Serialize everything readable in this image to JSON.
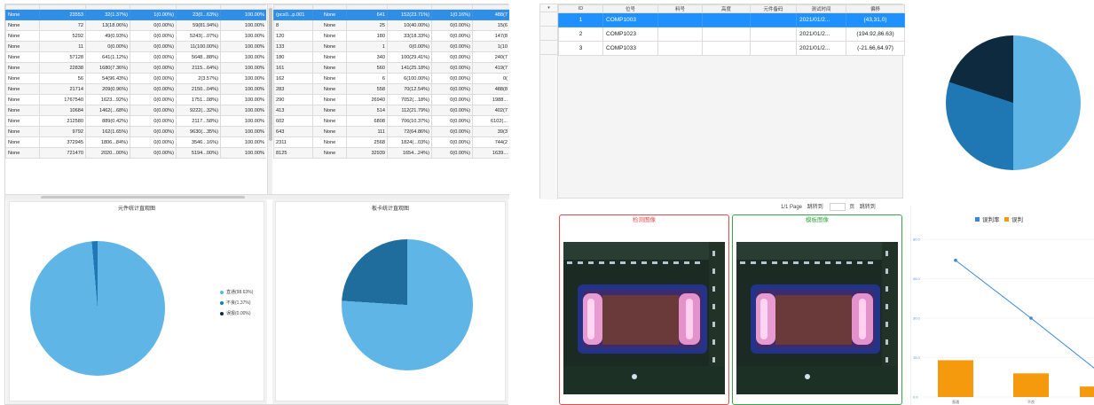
{
  "left_app": {
    "table_a": {
      "rows": [
        {
          "c0": "None",
          "c1": "23553",
          "c2": "32(1.37%)",
          "c3": "1(0.00%)",
          "c4": "23(0...63%)",
          "c5": "100.00%",
          "selected": true
        },
        {
          "c0": "None",
          "c1": "72",
          "c2": "13(18.06%)",
          "c3": "0(0.00%)",
          "c4": "59(81.94%)",
          "c5": "100.00%"
        },
        {
          "c0": "None",
          "c1": "5292",
          "c2": "49(0.93%)",
          "c3": "0(0.00%)",
          "c4": "5243(...07%)",
          "c5": "100.00%"
        },
        {
          "c0": "None",
          "c1": "11",
          "c2": "0(0.00%)",
          "c3": "0(0.00%)",
          "c4": "11(100.00%)",
          "c5": "100.00%"
        },
        {
          "c0": "None",
          "c1": "57128",
          "c2": "641(1.12%)",
          "c3": "0(0.00%)",
          "c4": "5648...88%)",
          "c5": "100.00%"
        },
        {
          "c0": "None",
          "c1": "22838",
          "c2": "1680(7.36%)",
          "c3": "0(0.00%)",
          "c4": "2115...64%)",
          "c5": "100.00%"
        },
        {
          "c0": "None",
          "c1": "56",
          "c2": "54(96.43%)",
          "c3": "0(0.00%)",
          "c4": "2(3.57%)",
          "c5": "100.00%"
        },
        {
          "c0": "None",
          "c1": "21714",
          "c2": "209(0.96%)",
          "c3": "0(0.00%)",
          "c4": "2150...04%)",
          "c5": "100.00%"
        },
        {
          "c0": "None",
          "c1": "1767540",
          "c2": "1623...92%)",
          "c3": "0(0.00%)",
          "c4": "1751...08%)",
          "c5": "100.00%"
        },
        {
          "c0": "None",
          "c1": "10684",
          "c2": "1462(...68%)",
          "c3": "0(0.00%)",
          "c4": "9222(...32%)",
          "c5": "100.00%"
        },
        {
          "c0": "None",
          "c1": "212580",
          "c2": "889(0.42%)",
          "c3": "0(0.00%)",
          "c4": "2117...58%)",
          "c5": "100.00%"
        },
        {
          "c0": "None",
          "c1": "9792",
          "c2": "162(1.65%)",
          "c3": "0(0.00%)",
          "c4": "9630(...35%)",
          "c5": "100.00%"
        },
        {
          "c0": "None",
          "c1": "372945",
          "c2": "1806...84%)",
          "c3": "0(0.00%)",
          "c4": "3546...16%)",
          "c5": "100.00%"
        },
        {
          "c0": "None",
          "c1": "721470",
          "c2": "2020...00%)",
          "c3": "0(0.00%)",
          "c4": "5194...00%)",
          "c5": "100.00%"
        }
      ]
    },
    "table_b": {
      "rows": [
        {
          "c0": "(pcs0...p.001",
          "c1": "None",
          "c2": "641",
          "c3": "152(23.71%)",
          "c4": "1(0.16%)",
          "c5": "488(7",
          "selected": true
        },
        {
          "c0": "8",
          "c1": "None",
          "c2": "25",
          "c3": "10(40.00%)",
          "c4": "0(0.00%)",
          "c5": "15(6"
        },
        {
          "c0": "120",
          "c1": "None",
          "c2": "180",
          "c3": "33(18.33%)",
          "c4": "0(0.00%)",
          "c5": "147(8"
        },
        {
          "c0": "133",
          "c1": "None",
          "c2": "1",
          "c3": "0(0.00%)",
          "c4": "0(0.00%)",
          "c5": "1(10"
        },
        {
          "c0": "180",
          "c1": "None",
          "c2": "340",
          "c3": "100(29.41%)",
          "c4": "0(0.00%)",
          "c5": "240(7"
        },
        {
          "c0": "161",
          "c1": "None",
          "c2": "560",
          "c3": "141(25.18%)",
          "c4": "0(0.00%)",
          "c5": "419(7"
        },
        {
          "c0": "162",
          "c1": "None",
          "c2": "6",
          "c3": "6(100.00%)",
          "c4": "0(0.00%)",
          "c5": "0("
        },
        {
          "c0": "283",
          "c1": "None",
          "c2": "558",
          "c3": "70(12.54%)",
          "c4": "0(0.00%)",
          "c5": "488(8"
        },
        {
          "c0": "290",
          "c1": "None",
          "c2": "26940",
          "c3": "7052(...18%)",
          "c4": "0(0.00%)",
          "c5": "1988..."
        },
        {
          "c0": "413",
          "c1": "None",
          "c2": "514",
          "c3": "112(21.79%)",
          "c4": "0(0.00%)",
          "c5": "402(7"
        },
        {
          "c0": "602",
          "c1": "None",
          "c2": "6808",
          "c3": "706(10.37%)",
          "c4": "0(0.00%)",
          "c5": "6102(..."
        },
        {
          "c0": "643",
          "c1": "None",
          "c2": "111",
          "c3": "72(64.86%)",
          "c4": "0(0.00%)",
          "c5": "39(3"
        },
        {
          "c0": "2311",
          "c1": "None",
          "c2": "2568",
          "c3": "1824(...03%)",
          "c4": "0(0.00%)",
          "c5": "744(2"
        },
        {
          "c0": "8125",
          "c1": "None",
          "c2": "32939",
          "c3": "1654...24%)",
          "c4": "0(0.00%)",
          "c5": "1639..."
        }
      ]
    },
    "pie_left": {
      "title": "元件统计直观图",
      "legend": [
        {
          "label": "直通(98.63%)",
          "color": "#5eb5e6"
        },
        {
          "label": "不良(1.37%)",
          "color": "#1f78b4"
        },
        {
          "label": "误报(0.00%)",
          "color": "#102a3c"
        }
      ],
      "slices": [
        0.9863,
        0.0137,
        0.0
      ]
    },
    "pie_right": {
      "title": "板卡统计直观图",
      "slices": [
        0.76,
        0.24
      ],
      "colors": [
        "#5eb5e6",
        "#1f6d9c"
      ]
    }
  },
  "right_app": {
    "table": {
      "header": {
        "corner": "▾",
        "id": "ID",
        "pos": "位号",
        "part": "料号",
        "height": "高度",
        "remark": "元件备码",
        "test_time": "测试时间",
        "offset": "偏移"
      },
      "rows": [
        {
          "id": "1",
          "pos": "COMP1003",
          "test_time": "2021/01/2...",
          "offset": "(43,31,0)",
          "selected": true
        },
        {
          "id": "2",
          "pos": "COMP1023",
          "test_time": "2021/01/2...",
          "offset": "(194.92,86.63)"
        },
        {
          "id": "3",
          "pos": "COMP1033",
          "test_time": "2021/01/2...",
          "offset": "(-21.66,64.97)"
        }
      ]
    },
    "pager": {
      "page": "1/1 Page",
      "jump": "跳转到",
      "unit": "页",
      "go": "跳转到"
    },
    "pie": {
      "slices": [
        0.5,
        0.3,
        0.2
      ],
      "colors": [
        "#5eb5e6",
        "#1f78b4",
        "#0e2a3f"
      ]
    },
    "image_panels": {
      "detect": "检测图像",
      "template": "模板图像"
    },
    "combo_chart": {
      "legend_line": "误判率",
      "legend_bar": "误判",
      "line_color": "#3a86d8",
      "bar_color": "#f59a0c",
      "y_ticks": [
        "60.0",
        "45.0",
        "30.0",
        "15.0",
        "0.0"
      ],
      "categories": [
        "直通",
        "不良",
        "误报"
      ],
      "bar_values": [
        14,
        9,
        4
      ],
      "line_values": [
        52,
        30,
        10
      ]
    }
  }
}
